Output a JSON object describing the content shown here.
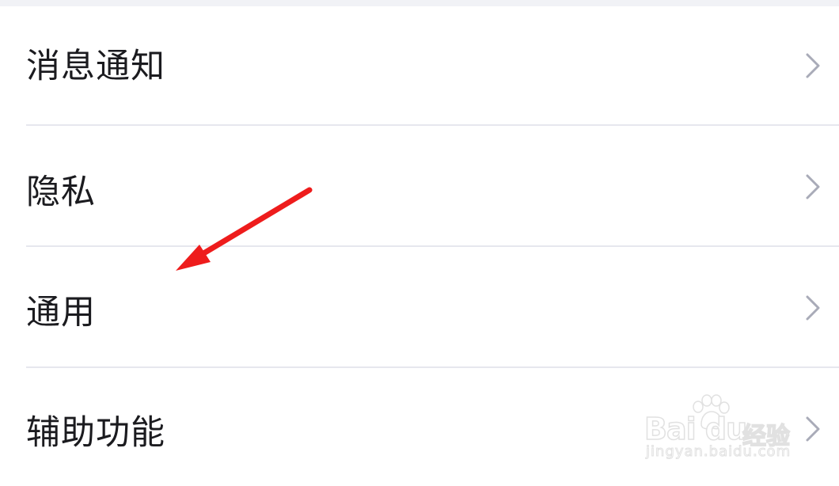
{
  "settings": {
    "items": [
      {
        "label": "消息通知",
        "icon": "chevron-right-icon"
      },
      {
        "label": "隐私",
        "icon": "chevron-right-icon"
      },
      {
        "label": "通用",
        "icon": "chevron-right-icon"
      },
      {
        "label": "辅助功能",
        "icon": "chevron-right-icon"
      }
    ]
  },
  "annotation": {
    "icon": "red-arrow-icon",
    "color": "#ee1c1c",
    "points_to": "通用"
  },
  "watermark": {
    "brand": "Bai du",
    "product": "经验",
    "url": "jingyan.baidu.com",
    "icon": "paw-icon"
  },
  "colors": {
    "background": "#ffffff",
    "top_bar": "#f1f2f6",
    "divider": "#e6e7ee",
    "text": "#1b1b1f",
    "chevron": "#a9abb8"
  }
}
